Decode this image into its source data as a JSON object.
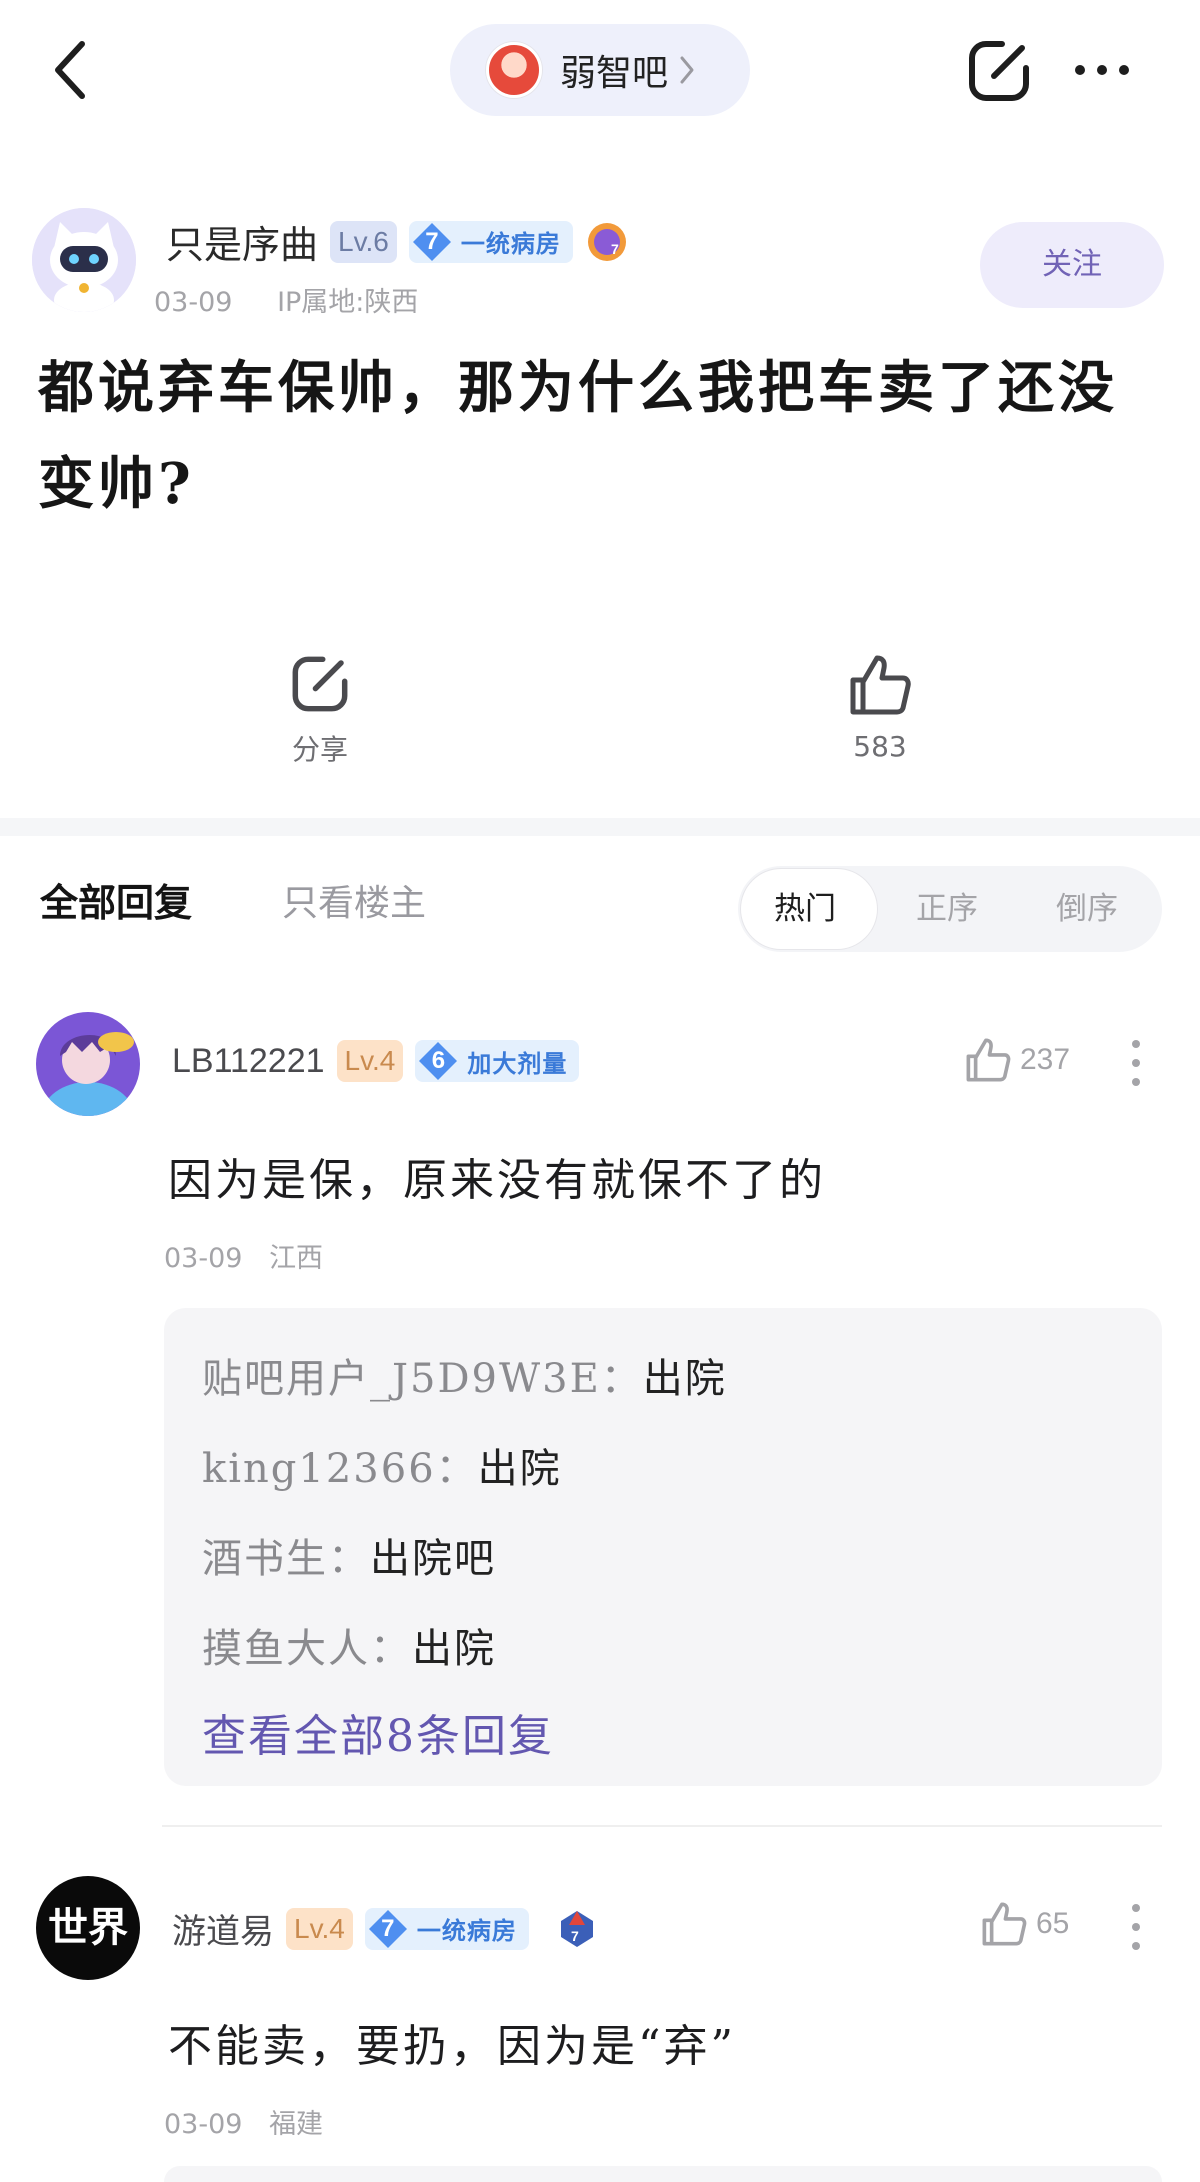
{
  "nav": {
    "forum_name": "弱智吧"
  },
  "post": {
    "author": {
      "name": "只是序曲",
      "level": "Lv.6",
      "title_level": "7",
      "title": "一统病房",
      "medal_level": "7"
    },
    "date": "03-09",
    "ip": "IP属地:陕西",
    "follow_label": "关注",
    "title": "都说弃车保帅，那为什么我把车卖了还没变帅?",
    "share_label": "分享",
    "like_count": "583"
  },
  "tabs": {
    "all_replies": "全部回复",
    "op_only": "只看楼主",
    "sort": [
      "热门",
      "正序",
      "倒序"
    ]
  },
  "comments": [
    {
      "name": "LB112221",
      "level": "Lv.4",
      "title_level": "6",
      "title": "加大剂量",
      "likes": "237",
      "text": "因为是保，原来没有就保不了的",
      "date": "03-09",
      "location": "江西",
      "replies": [
        {
          "user": "贴吧用户_J5D9W3E：",
          "text": "出院"
        },
        {
          "user": "king12366：",
          "text": "出院"
        },
        {
          "user": "酒书生：",
          "text": "出院吧"
        },
        {
          "user": "摸鱼大人：",
          "text": "出院"
        }
      ],
      "view_all": "查看全部8条回复"
    },
    {
      "name": "游道易",
      "level": "Lv.4",
      "title_level": "7",
      "title": "一统病房",
      "medal_level": "7",
      "avatar_text": "世界",
      "likes": "65",
      "text": "不能卖，要扔，因为是“弃”",
      "date": "03-09",
      "location": "福建"
    }
  ],
  "colors": {
    "accent_purple": "#6357b0",
    "title_blue": "#3a7ad8",
    "level_orange": "#c98a4e",
    "level_blue": "#6c7ca4"
  }
}
